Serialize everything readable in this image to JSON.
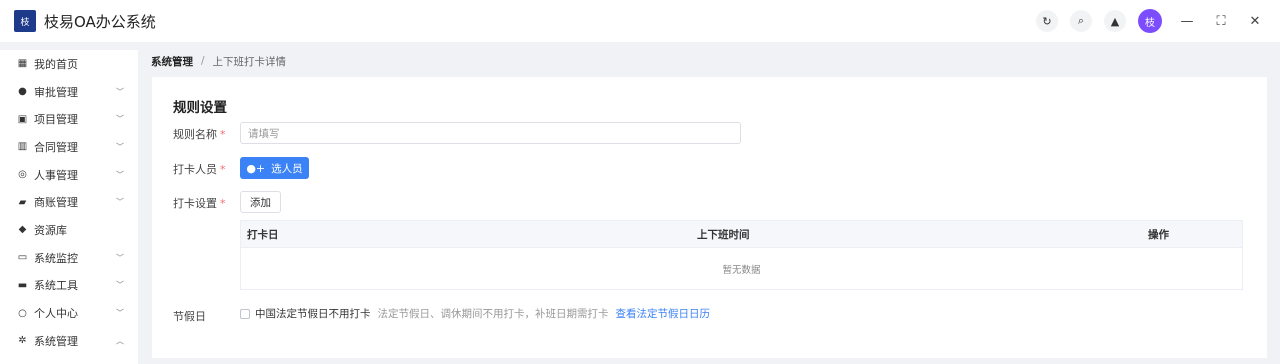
{
  "app": {
    "title": "枝易OA办公系统",
    "logo_text": "枝"
  },
  "header": {
    "icons": [
      "refresh-icon",
      "search-icon",
      "bell-icon"
    ],
    "avatar_text": "枝",
    "window_controls": [
      "minimize-icon",
      "maximize-icon",
      "close-icon"
    ]
  },
  "sidebar": {
    "items": [
      {
        "label": "我的首页",
        "icon": "grid-icon",
        "glyph": "▦",
        "expandable": false
      },
      {
        "label": "审批管理",
        "icon": "user-icon",
        "glyph": "●",
        "expandable": true
      },
      {
        "label": "项目管理",
        "icon": "folder-icon",
        "glyph": "▣",
        "expandable": true
      },
      {
        "label": "合同管理",
        "icon": "bar-chart-icon",
        "glyph": "▥",
        "expandable": true
      },
      {
        "label": "人事管理",
        "icon": "check-circle-icon",
        "glyph": "◎",
        "expandable": true
      },
      {
        "label": "商账管理",
        "icon": "wallet-icon",
        "glyph": "▰",
        "expandable": true
      },
      {
        "label": "资源库",
        "icon": "location-icon",
        "glyph": "◆",
        "expandable": false
      },
      {
        "label": "系统监控",
        "icon": "monitor-icon",
        "glyph": "▭",
        "expandable": true
      },
      {
        "label": "系统工具",
        "icon": "toolbox-icon",
        "glyph": "▬",
        "expandable": true
      },
      {
        "label": "个人中心",
        "icon": "person-icon",
        "glyph": "○",
        "expandable": true
      },
      {
        "label": "系统管理",
        "icon": "gear-icon",
        "glyph": "✲",
        "expandable": true,
        "expanded": true
      }
    ]
  },
  "breadcrumb": {
    "parent": "系统管理",
    "separator": "/",
    "current": "上下班打卡详情"
  },
  "form": {
    "section_title": "规则设置",
    "rule_name_label": "规则名称",
    "rule_name_placeholder": "请填写",
    "members_label": "打卡人员",
    "select_members_button": "选人员",
    "checkin_settings_label": "打卡设置",
    "add_button": "添加",
    "required_mark": "*"
  },
  "table": {
    "columns": [
      "打卡日",
      "上下班时间",
      "操作"
    ],
    "empty_text": "暂无数据"
  },
  "holiday": {
    "label": "节假日",
    "checkbox_label": "中国法定节假日不用打卡",
    "checked": false,
    "hint": "法定节假日、调休期间不用打卡，补班日期需打卡",
    "link": "查看法定节假日日历"
  },
  "colors": {
    "primary": "#3b82f6",
    "required": "#f56c6c",
    "avatar": "#7c4dff",
    "logo": "#1e3a8a"
  }
}
